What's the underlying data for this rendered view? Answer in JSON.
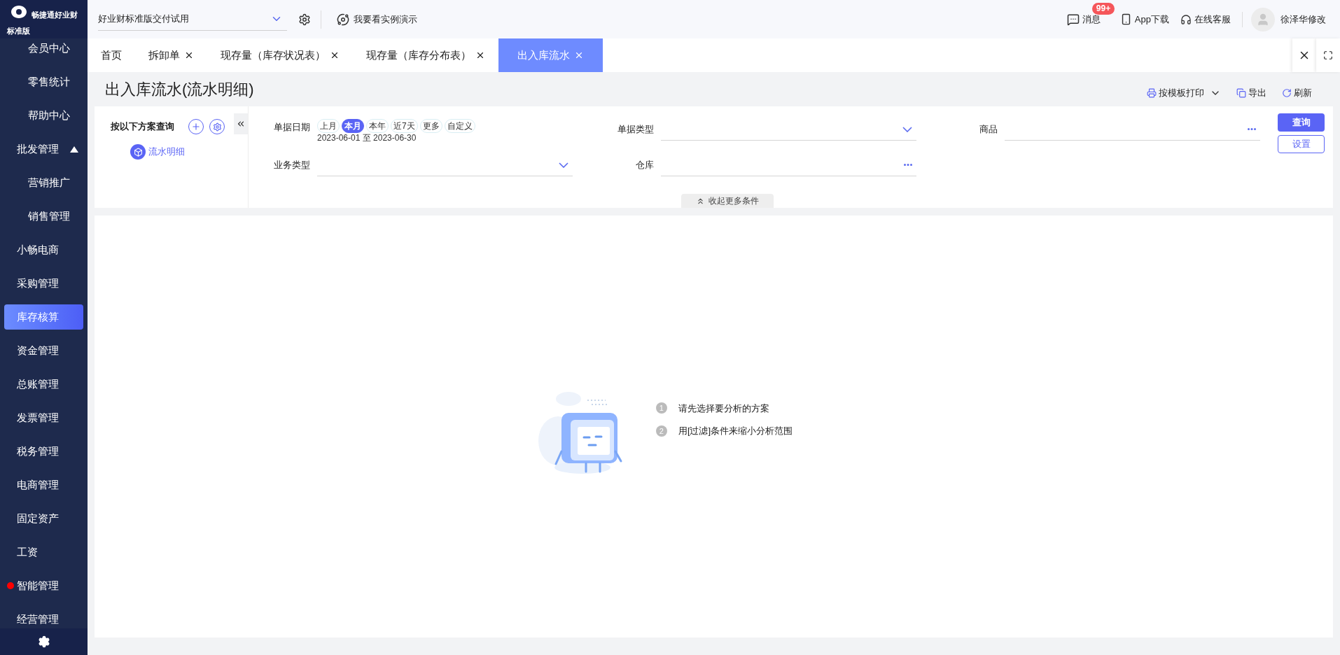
{
  "brand": {
    "name": "畅捷通好业财",
    "edition": "标准版"
  },
  "topbar": {
    "account": "好业财标准版交付试用",
    "demo": "我要看实例演示",
    "messages": {
      "label": "消息",
      "badge": "99+"
    },
    "app": "App下载",
    "service": "在线客服",
    "user": "徐泽华修改"
  },
  "sidebar": {
    "continued_children": [
      {
        "label": "会员中心",
        "selected": false
      },
      {
        "label": "零售统计",
        "selected": false
      },
      {
        "label": "帮助中心",
        "selected": false
      }
    ],
    "items": [
      {
        "label": "批发管理",
        "selected": false,
        "expanded": true,
        "dot": false,
        "children": [
          {
            "label": "营销推广",
            "selected": false
          },
          {
            "label": "销售管理",
            "selected": false
          }
        ]
      },
      {
        "label": "小畅电商",
        "selected": false,
        "dot": false
      },
      {
        "label": "采购管理",
        "selected": false,
        "dot": false
      },
      {
        "label": "库存核算",
        "selected": true,
        "dot": false
      },
      {
        "label": "资金管理",
        "selected": false,
        "dot": false
      },
      {
        "label": "总账管理",
        "selected": false,
        "dot": false
      },
      {
        "label": "发票管理",
        "selected": false,
        "dot": false
      },
      {
        "label": "税务管理",
        "selected": false,
        "dot": false
      },
      {
        "label": "电商管理",
        "selected": false,
        "dot": false
      },
      {
        "label": "固定资产",
        "selected": false,
        "dot": false
      },
      {
        "label": "工资",
        "selected": false,
        "dot": false
      },
      {
        "label": "智能管理",
        "selected": false,
        "dot": true
      },
      {
        "label": "经营管理",
        "selected": false,
        "dot": false
      }
    ]
  },
  "tabs": [
    {
      "label": "首页",
      "selected": false,
      "closable": false
    },
    {
      "label": "拆卸单",
      "selected": false,
      "closable": true
    },
    {
      "label": "现存量（库存状况表）",
      "selected": false,
      "closable": true
    },
    {
      "label": "现存量（库存分布表）",
      "selected": false,
      "closable": true
    },
    {
      "label": "出入库流水",
      "selected": true,
      "closable": true
    }
  ],
  "page": {
    "title": "出入库流水(流水明细)",
    "toolbar": [
      "按模板打印",
      "导出",
      "刷新"
    ]
  },
  "schemes": {
    "title": "按以下方案查询",
    "items": [
      {
        "label": "流水明细",
        "selected": true
      }
    ]
  },
  "filters": {
    "date": {
      "label": "单据日期",
      "presets": [
        {
          "label": "上月",
          "selected": false
        },
        {
          "label": "本月",
          "selected": true
        },
        {
          "label": "本年",
          "selected": false
        },
        {
          "label": "近7天",
          "selected": false
        },
        {
          "label": "更多",
          "selected": false
        },
        {
          "label": "自定义",
          "selected": false
        }
      ],
      "range": "2023-06-01 至 2023-06-30"
    },
    "fields": [
      {
        "label": "单据类型",
        "kind": "select"
      },
      {
        "label": "商品",
        "kind": "lookup"
      },
      {
        "label": "业务类型",
        "kind": "select"
      },
      {
        "label": "仓库",
        "kind": "lookup"
      }
    ],
    "query": "查询",
    "settings": "设置",
    "collapse": "收起更多条件"
  },
  "empty": {
    "steps": [
      {
        "number": "1",
        "text": "请先选择要分析的方案"
      },
      {
        "number": "2",
        "text": "用[过滤]条件来缩小分析范围"
      }
    ]
  }
}
